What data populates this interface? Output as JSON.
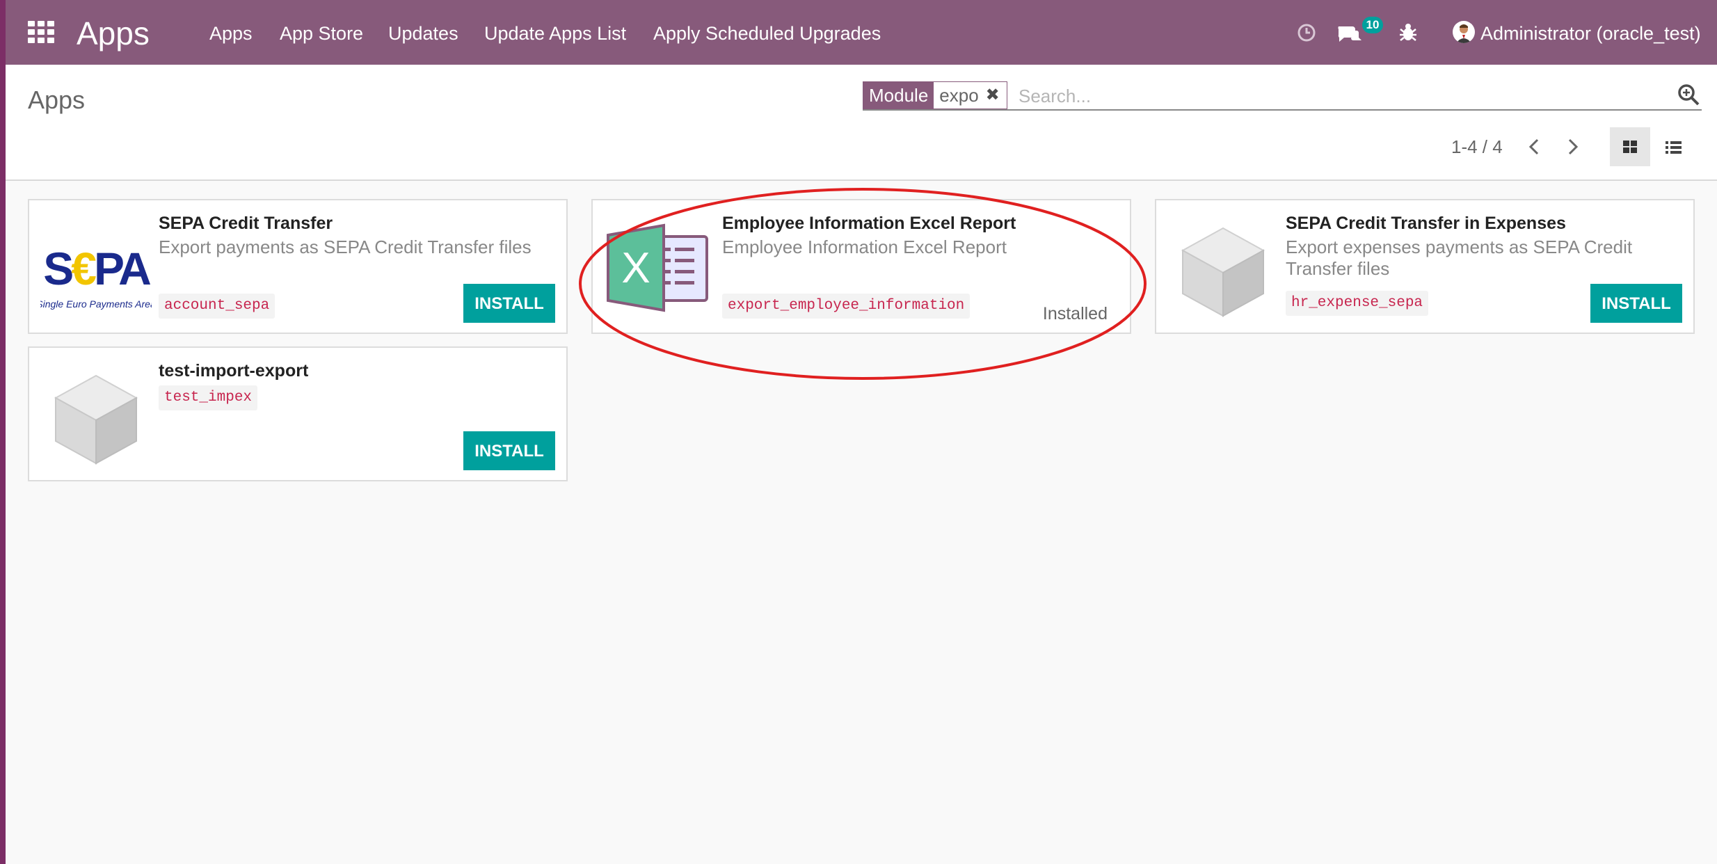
{
  "navbar": {
    "brand": "Apps",
    "menu": [
      "Apps",
      "App Store",
      "Updates",
      "Update Apps List",
      "Apply Scheduled Upgrades"
    ],
    "messages_count": "10",
    "user": "Administrator (oracle_test)",
    "icons": [
      "apps-grid-icon",
      "clock-icon",
      "chat-icon",
      "bug-icon",
      "avatar"
    ]
  },
  "control_panel": {
    "breadcrumb": "Apps",
    "facet_label": "Module",
    "facet_value": "expo",
    "search_placeholder": "Search...",
    "pager": "1-4 / 4"
  },
  "apps": [
    {
      "name": "SEPA Credit Transfer",
      "description": "Export payments as SEPA Credit Transfer files",
      "technical_name": "account_sepa",
      "action": "INSTALL",
      "icon": "sepa-logo",
      "logo_text": "S€PA",
      "logo_subtitle": "Single Euro Payments Area"
    },
    {
      "name": "Employee Information Excel Report",
      "description": "Employee Information Excel Report",
      "technical_name": "export_employee_information",
      "status": "Installed",
      "icon": "excel-icon",
      "logo_text": "X"
    },
    {
      "name": "SEPA Credit Transfer in Expenses",
      "description": "Export expenses payments as SEPA Credit Transfer files",
      "technical_name": "hr_expense_sepa",
      "action": "INSTALL",
      "icon": "cube-icon"
    },
    {
      "name": "test-import-export",
      "description": "",
      "technical_name": "test_impex",
      "action": "INSTALL",
      "icon": "cube-icon"
    }
  ],
  "colors": {
    "navbar": "#875a7b",
    "accent": "#00a09d",
    "tag_text": "#c7254e",
    "highlight": "#e02020"
  }
}
